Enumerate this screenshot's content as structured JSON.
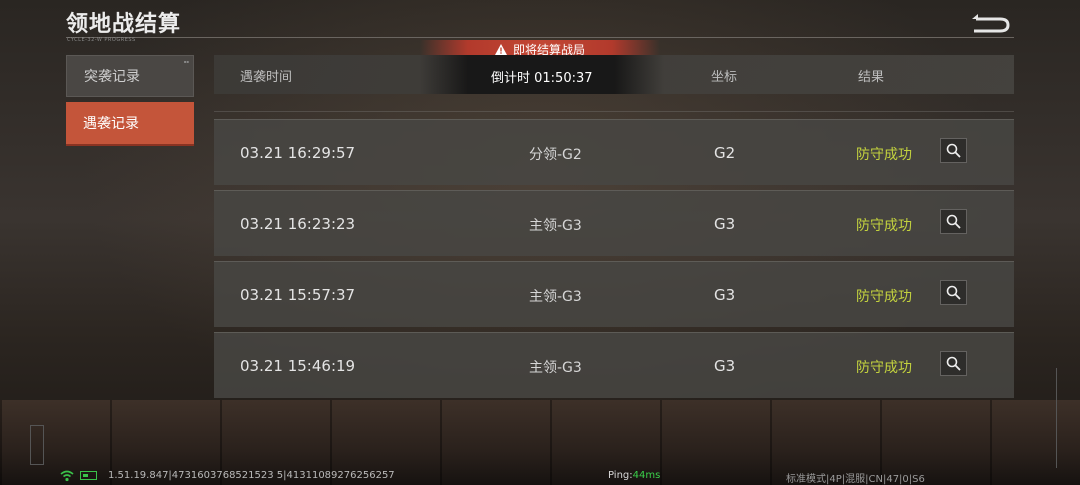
{
  "header": {
    "title": "领地战结算",
    "subtitle": "CYCLE-32-W PROGRESS"
  },
  "banner": {
    "text": "即将结算战局"
  },
  "sidebar": {
    "items": [
      {
        "label": "突袭记录",
        "active": false
      },
      {
        "label": "遇袭记录",
        "active": true
      }
    ]
  },
  "table": {
    "columns": {
      "time": "遇袭时间",
      "coord": "坐标",
      "result": "结果"
    },
    "countdown": "倒计时 01:50:37",
    "rows": [
      {
        "time": "03.21 16:29:57",
        "territory": "分领-G2",
        "coord": "G2",
        "result": "防守成功"
      },
      {
        "time": "03.21 16:23:23",
        "territory": "主领-G3",
        "coord": "G3",
        "result": "防守成功"
      },
      {
        "time": "03.21 15:57:37",
        "territory": "主领-G3",
        "coord": "G3",
        "result": "防守成功"
      },
      {
        "time": "03.21 15:46:19",
        "territory": "主领-G3",
        "coord": "G3",
        "result": "防守成功"
      }
    ]
  },
  "status": {
    "version": "1.51.19.847|4731603768521523 5|41311089276256257",
    "ping_label": "Ping:",
    "ping_value": "44ms",
    "mode": "标准模式|4P|混服|CN|47|0|S6"
  },
  "colors": {
    "accent": "#c4553a",
    "success": "#c3d23e",
    "banner": "#c24634"
  }
}
